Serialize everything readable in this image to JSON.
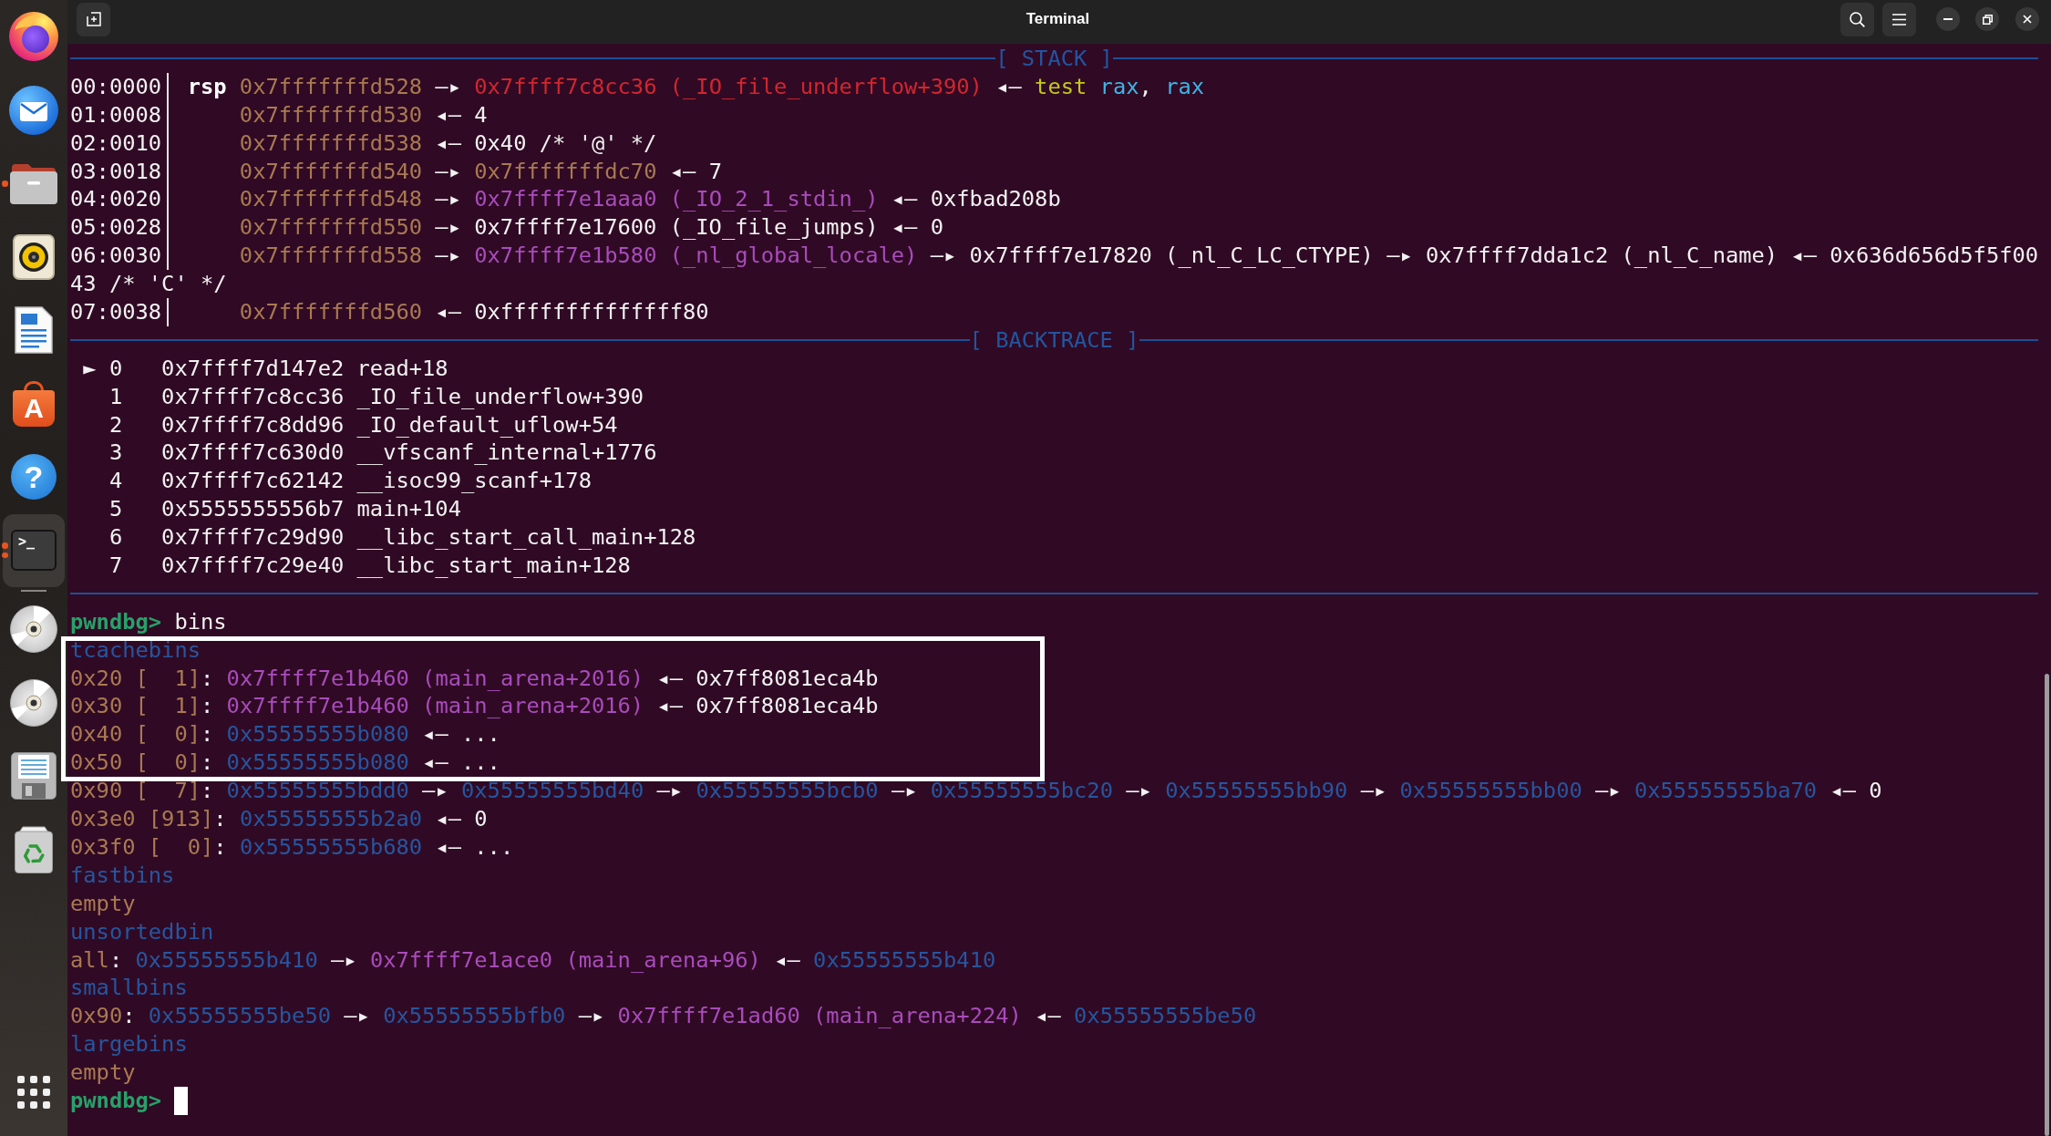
{
  "window": {
    "title": "Terminal"
  },
  "dock": {
    "apps": [
      {
        "kind": "browser",
        "selected": false,
        "running": false,
        "multiple": false
      },
      {
        "kind": "mail",
        "selected": false,
        "running": false,
        "multiple": false
      },
      {
        "kind": "files",
        "selected": false,
        "running": true,
        "multiple": false
      },
      {
        "kind": "music",
        "selected": false,
        "running": false,
        "multiple": false
      },
      {
        "kind": "writer",
        "selected": false,
        "running": false,
        "multiple": false
      },
      {
        "kind": "store",
        "label": "A",
        "selected": false,
        "running": false,
        "multiple": false
      },
      {
        "kind": "help",
        "label": "?",
        "selected": false,
        "running": false,
        "multiple": false
      },
      {
        "kind": "terminal",
        "label": ">_",
        "selected": true,
        "running": true,
        "multiple": true
      }
    ],
    "devices": [
      {
        "kind": "disc",
        "selected": false,
        "running": false,
        "multiple": false
      },
      {
        "kind": "disc",
        "selected": false,
        "running": false,
        "multiple": false
      },
      {
        "kind": "floppy",
        "selected": false,
        "running": false,
        "multiple": false
      },
      {
        "kind": "trash",
        "selected": false,
        "running": false,
        "multiple": false
      }
    ]
  },
  "terminal": {
    "lines": [
      {
        "kind": "header",
        "text": "[ STACK ]"
      },
      {
        "kind": "stack",
        "offset": "00:0000",
        "register": "rsp",
        "segments": [
          {
            "kind": "stack",
            "text": "0x7fffffffd528"
          },
          {
            "kind": "plain",
            "text": " —▸ "
          },
          {
            "kind": "code",
            "text": "0x7ffff7c8cc36 (_IO_file_underflow+390)"
          },
          {
            "kind": "plain",
            "text": " ◂— "
          },
          {
            "kind": "mnemonic",
            "text": "test "
          },
          {
            "kind": "register",
            "text": "rax"
          },
          {
            "kind": "plain",
            "text": ", "
          },
          {
            "kind": "register",
            "text": "rax"
          }
        ]
      },
      {
        "kind": "stack",
        "offset": "01:0008",
        "segments": [
          {
            "kind": "stack",
            "text": "0x7fffffffd530"
          },
          {
            "kind": "plain",
            "text": " ◂— 4"
          }
        ]
      },
      {
        "kind": "stack",
        "offset": "02:0010",
        "segments": [
          {
            "kind": "stack",
            "text": "0x7fffffffd538"
          },
          {
            "kind": "plain",
            "text": " ◂— 0x40 /* '@' */"
          }
        ]
      },
      {
        "kind": "stack",
        "offset": "03:0018",
        "segments": [
          {
            "kind": "stack",
            "text": "0x7fffffffd540"
          },
          {
            "kind": "plain",
            "text": " —▸ "
          },
          {
            "kind": "stack",
            "text": "0x7fffffffdc70"
          },
          {
            "kind": "plain",
            "text": " ◂— 7"
          }
        ]
      },
      {
        "kind": "stack",
        "offset": "04:0020",
        "segments": [
          {
            "kind": "stack",
            "text": "0x7fffffffd548"
          },
          {
            "kind": "plain",
            "text": " —▸ "
          },
          {
            "kind": "data",
            "text": "0x7ffff7e1aaa0 (_IO_2_1_stdin_)"
          },
          {
            "kind": "plain",
            "text": " ◂— 0xfbad208b"
          }
        ]
      },
      {
        "kind": "stack",
        "offset": "05:0028",
        "segments": [
          {
            "kind": "stack",
            "text": "0x7fffffffd550"
          },
          {
            "kind": "plain",
            "text": " —▸ 0x7ffff7e17600 (_IO_file_jumps) ◂— 0"
          }
        ]
      },
      {
        "kind": "stack",
        "offset": "06:0030",
        "segments": [
          {
            "kind": "stack",
            "text": "0x7fffffffd558"
          },
          {
            "kind": "plain",
            "text": " —▸ "
          },
          {
            "kind": "data",
            "text": "0x7ffff7e1b580 (_nl_global_locale)"
          },
          {
            "kind": "plain",
            "text": " —▸ 0x7ffff7e17820 (_nl_C_LC_CTYPE) —▸ 0x7ffff7dda1c2 (_nl_C_name) ◂— 0x636d656d5f5f00"
          }
        ]
      },
      {
        "kind": "wrap",
        "segments": [
          {
            "kind": "plain",
            "text": "43 /* 'C' */"
          }
        ]
      },
      {
        "kind": "stack",
        "offset": "07:0038",
        "segments": [
          {
            "kind": "stack",
            "text": "0x7fffffffd560"
          },
          {
            "kind": "plain",
            "text": " ◂— 0xffffffffffffff80"
          }
        ]
      },
      {
        "kind": "header",
        "text": "[ BACKTRACE ]"
      },
      {
        "kind": "frame",
        "marker": "►",
        "index": "0",
        "address": "0x7ffff7d147e2",
        "symbol": "read+18"
      },
      {
        "kind": "frame",
        "index": "1",
        "address": "0x7ffff7c8cc36",
        "symbol": "_IO_file_underflow+390"
      },
      {
        "kind": "frame",
        "index": "2",
        "address": "0x7ffff7c8dd96",
        "symbol": "_IO_default_uflow+54"
      },
      {
        "kind": "frame",
        "index": "3",
        "address": "0x7ffff7c630d0",
        "symbol": "__vfscanf_internal+1776"
      },
      {
        "kind": "frame",
        "index": "4",
        "address": "0x7ffff7c62142",
        "symbol": "__isoc99_scanf+178"
      },
      {
        "kind": "frame",
        "index": "5",
        "address": "0x5555555556b7",
        "symbol": "main+104"
      },
      {
        "kind": "frame",
        "index": "6",
        "address": "0x7ffff7c29d90",
        "symbol": "__libc_start_call_main+128"
      },
      {
        "kind": "frame",
        "index": "7",
        "address": "0x7ffff7c29e40",
        "symbol": "__libc_start_main+128"
      },
      {
        "kind": "rule"
      },
      {
        "kind": "command",
        "prompt": "pwndbg>",
        "command": "bins",
        "cursor": false
      },
      {
        "kind": "output",
        "segments": [
          {
            "kind": "heap",
            "text": "tcachebins"
          }
        ]
      },
      {
        "kind": "output",
        "segments": [
          {
            "kind": "bin",
            "text": "0x20 [  1]"
          },
          {
            "kind": "plain",
            "text": ": "
          },
          {
            "kind": "data",
            "text": "0x7ffff7e1b460 (main_arena+2016)"
          },
          {
            "kind": "plain",
            "text": " ◂— 0x7ff8081eca4b"
          }
        ]
      },
      {
        "kind": "output",
        "segments": [
          {
            "kind": "bin",
            "text": "0x30 [  1]"
          },
          {
            "kind": "plain",
            "text": ": "
          },
          {
            "kind": "data",
            "text": "0x7ffff7e1b460 (main_arena+2016)"
          },
          {
            "kind": "plain",
            "text": " ◂— 0x7ff8081eca4b"
          }
        ]
      },
      {
        "kind": "output",
        "segments": [
          {
            "kind": "bin",
            "text": "0x40 [  0]"
          },
          {
            "kind": "plain",
            "text": ": "
          },
          {
            "kind": "heap",
            "text": "0x55555555b080"
          },
          {
            "kind": "plain",
            "text": " ◂— ..."
          }
        ]
      },
      {
        "kind": "output",
        "segments": [
          {
            "kind": "bin",
            "text": "0x50 [  0]"
          },
          {
            "kind": "plain",
            "text": ": "
          },
          {
            "kind": "heap",
            "text": "0x55555555b080"
          },
          {
            "kind": "plain",
            "text": " ◂— ..."
          }
        ]
      },
      {
        "kind": "output",
        "segments": [
          {
            "kind": "bin",
            "text": "0x90 [  7]"
          },
          {
            "kind": "plain",
            "text": ": "
          },
          {
            "kind": "heap",
            "text": "0x55555555bdd0"
          },
          {
            "kind": "plain",
            "text": " —▸ "
          },
          {
            "kind": "heap",
            "text": "0x55555555bd40"
          },
          {
            "kind": "plain",
            "text": " —▸ "
          },
          {
            "kind": "heap",
            "text": "0x55555555bcb0"
          },
          {
            "kind": "plain",
            "text": " —▸ "
          },
          {
            "kind": "heap",
            "text": "0x55555555bc20"
          },
          {
            "kind": "plain",
            "text": " —▸ "
          },
          {
            "kind": "heap",
            "text": "0x55555555bb90"
          },
          {
            "kind": "plain",
            "text": " —▸ "
          },
          {
            "kind": "heap",
            "text": "0x55555555bb00"
          },
          {
            "kind": "plain",
            "text": " —▸ "
          },
          {
            "kind": "heap",
            "text": "0x55555555ba70"
          },
          {
            "kind": "plain",
            "text": " ◂— 0"
          }
        ]
      },
      {
        "kind": "output",
        "segments": [
          {
            "kind": "bin",
            "text": "0x3e0 [913]"
          },
          {
            "kind": "plain",
            "text": ": "
          },
          {
            "kind": "heap",
            "text": "0x55555555b2a0"
          },
          {
            "kind": "plain",
            "text": " ◂— 0"
          }
        ]
      },
      {
        "kind": "output",
        "segments": [
          {
            "kind": "bin",
            "text": "0x3f0 [  0]"
          },
          {
            "kind": "plain",
            "text": ": "
          },
          {
            "kind": "heap",
            "text": "0x55555555b680"
          },
          {
            "kind": "plain",
            "text": " ◂— ..."
          }
        ]
      },
      {
        "kind": "output",
        "segments": [
          {
            "kind": "heap",
            "text": "fastbins"
          }
        ]
      },
      {
        "kind": "output",
        "segments": [
          {
            "kind": "bin",
            "text": "empty"
          }
        ]
      },
      {
        "kind": "output",
        "segments": [
          {
            "kind": "heap",
            "text": "unsortedbin"
          }
        ]
      },
      {
        "kind": "output",
        "segments": [
          {
            "kind": "bin",
            "text": "all"
          },
          {
            "kind": "plain",
            "text": ": "
          },
          {
            "kind": "heap",
            "text": "0x55555555b410"
          },
          {
            "kind": "plain",
            "text": " —▸ "
          },
          {
            "kind": "data",
            "text": "0x7ffff7e1ace0 (main_arena+96)"
          },
          {
            "kind": "plain",
            "text": " ◂— "
          },
          {
            "kind": "heap",
            "text": "0x55555555b410"
          }
        ]
      },
      {
        "kind": "output",
        "segments": [
          {
            "kind": "heap",
            "text": "smallbins"
          }
        ]
      },
      {
        "kind": "output",
        "segments": [
          {
            "kind": "bin",
            "text": "0x90"
          },
          {
            "kind": "plain",
            "text": ": "
          },
          {
            "kind": "heap",
            "text": "0x55555555be50"
          },
          {
            "kind": "plain",
            "text": " —▸ "
          },
          {
            "kind": "heap",
            "text": "0x55555555bfb0"
          },
          {
            "kind": "plain",
            "text": " —▸ "
          },
          {
            "kind": "data",
            "text": "0x7ffff7e1ad60 (main_arena+224)"
          },
          {
            "kind": "plain",
            "text": " ◂— "
          },
          {
            "kind": "heap",
            "text": "0x55555555be50"
          }
        ]
      },
      {
        "kind": "output",
        "segments": [
          {
            "kind": "heap",
            "text": "largebins"
          }
        ]
      },
      {
        "kind": "output",
        "segments": [
          {
            "kind": "bin",
            "text": "empty"
          }
        ]
      },
      {
        "kind": "command",
        "prompt": "pwndbg>",
        "cursor": true
      }
    ]
  }
}
